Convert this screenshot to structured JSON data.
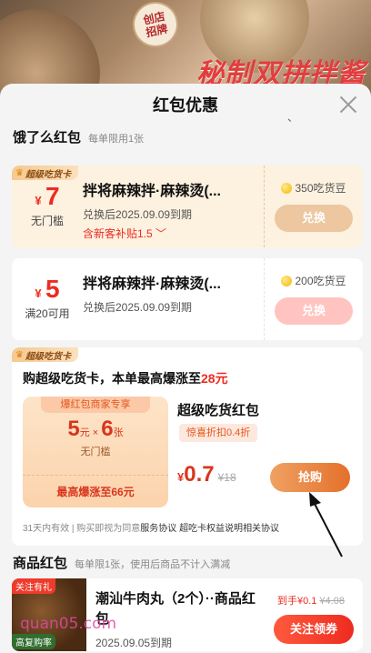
{
  "banner": {
    "stamp_line1": "创店",
    "stamp_line2": "招牌",
    "slogan": "秘制双拼拌酱"
  },
  "sheet": {
    "title": "红包优惠",
    "tick": "、"
  },
  "eleme_section": {
    "title": "饿了么红包",
    "note": "每单限用1张"
  },
  "coupons": [
    {
      "badge": "超级吃货卡",
      "currency": "¥",
      "amount": "7",
      "threshold": "无门槛",
      "name": "拌将麻辣拌·麻辣烫(...",
      "expire": "兑换后2025.09.09到期",
      "subsidy": "含新客补贴1.5",
      "beans": "350吃货豆",
      "button": "兑换"
    },
    {
      "currency": "¥",
      "amount": "5",
      "threshold": "满20可用",
      "name": "拌将麻辣拌·麻辣烫(...",
      "expire": "兑换后2025.09.09到期",
      "beans": "200吃货豆",
      "button": "兑换"
    }
  ],
  "super_card": {
    "badge": "超级吃货卡",
    "title_prefix": "购超级吃货卡，本单最高爆涨至",
    "title_highlight": "28元",
    "ticket_tag": "爆红包商家专享",
    "ticket_amount": "5",
    "ticket_unit": "元 × ",
    "ticket_count": "6",
    "ticket_count_unit": "张",
    "ticket_cond": "无门槛",
    "ticket_foot": "最高爆涨至66元",
    "card_title": "超级吃货红包",
    "discount": "惊喜折扣0.4折",
    "price_currency": "¥",
    "price": "0.7",
    "orig_price": "¥18",
    "button": "抢购",
    "terms_prefix": "31天内有效 | 购买即视为同意",
    "terms_link1": "服务协议",
    "terms_link2": "超吃卡权益说明",
    "terms_link3": "相关协议"
  },
  "goods_section": {
    "title": "商品红包",
    "note": "每单限1张，使用后商品不计入满减"
  },
  "goods": {
    "tag": "关注有礼",
    "tag2": "高复购率",
    "name": "潮汕牛肉丸（2个）··商品红包",
    "expire": "2025.09.05到期",
    "price": "到手¥0.1",
    "orig_price": "¥4.08",
    "button": "关注领券"
  },
  "watermark": "quan05.com"
}
